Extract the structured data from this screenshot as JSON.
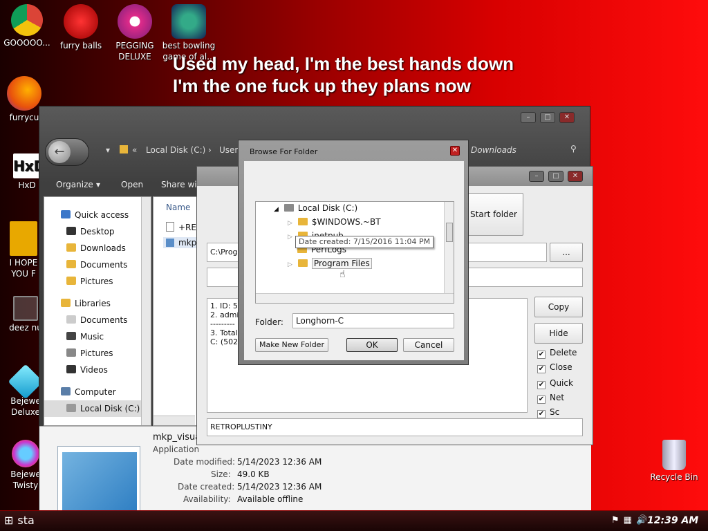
{
  "desktop": {
    "icons": [
      {
        "label": "GOOOOO..."
      },
      {
        "label": "furry balls"
      },
      {
        "label": "PEGGING DELUXE"
      },
      {
        "label": "best bowling game of al..."
      },
      {
        "label": "furrycu"
      },
      {
        "label": "HxD"
      },
      {
        "label": "I HOPE YOU F"
      },
      {
        "label": "deez nu"
      },
      {
        "label": "Bejewe Deluxe"
      },
      {
        "label": "Bejewe Twisty"
      },
      {
        "label": "Recycle Bin"
      }
    ],
    "lyrics": [
      "Used my head, I'm the best hands down",
      "I'm the one fuck up they plans now"
    ]
  },
  "explorer": {
    "address": [
      "Local Disk (C:)",
      "User",
      "ch Downloads"
    ],
    "toolbar": [
      "Organize",
      "Open",
      "Share wit"
    ],
    "nav": [
      {
        "label": "Quick access"
      },
      {
        "label": "Desktop"
      },
      {
        "label": "Downloads"
      },
      {
        "label": "Documents"
      },
      {
        "label": "Pictures"
      },
      {
        "label": "Libraries"
      },
      {
        "label": "Documents"
      },
      {
        "label": "Music"
      },
      {
        "label": "Pictures"
      },
      {
        "label": "Videos"
      },
      {
        "label": "Computer"
      },
      {
        "label": "Local Disk (C:)"
      }
    ],
    "column_name": "Name",
    "files": [
      "+REA",
      "mkp_"
    ],
    "details": {
      "filename": "mkp_visual",
      "type": "Application",
      "labels": [
        "Date modified:",
        "Size:",
        "Date created:",
        "Availability:"
      ],
      "values": [
        "5/14/2023 12:36 AM",
        "49.0 KB",
        "5/14/2023 12:36 AM",
        "Available offline"
      ]
    }
  },
  "app": {
    "start_folder": "Start folder",
    "path_value": "C:\\Progr",
    "browse_label": "...",
    "log": "1. ID: 53\n2. admin\n---------\n3. Total:\nC: (502C",
    "buttons": {
      "copy": "Copy",
      "hide": "Hide"
    },
    "checks": [
      "Delete",
      "Close",
      "Quick",
      "Net",
      "Sc"
    ],
    "status_value": "RETROPLUSTINY"
  },
  "dialog": {
    "title": "Browse For Folder",
    "tree": {
      "root": "Local Disk (C:)",
      "items": [
        "$WINDOWS.~BT",
        "inetpub",
        "PerfLogs",
        "Program Files"
      ]
    },
    "tooltip": "Date created: 7/15/2016 11:04 PM",
    "folder_label": "Folder:",
    "folder_value": "Longhorn-C",
    "buttons": {
      "new_folder": "Make New Folder",
      "ok": "OK",
      "cancel": "Cancel"
    }
  },
  "taskbar": {
    "start": "sta",
    "clock": "12:39 AM"
  }
}
